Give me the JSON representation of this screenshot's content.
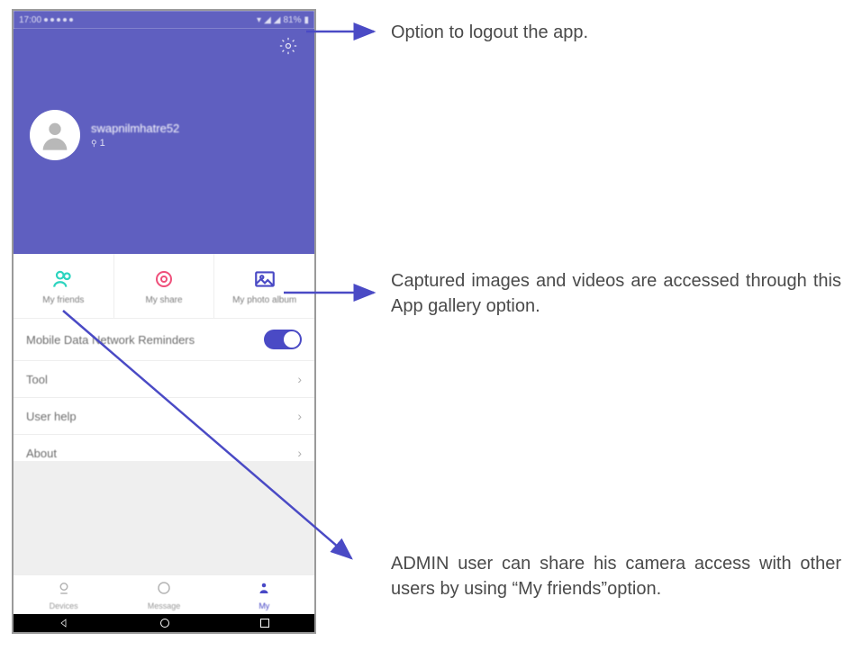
{
  "status": {
    "time": "17:00",
    "right": "81%"
  },
  "header": {
    "username": "swapnilmhatre52",
    "location_count": "1"
  },
  "tiles": [
    {
      "label": "My friends"
    },
    {
      "label": "My share"
    },
    {
      "label": "My photo album"
    }
  ],
  "rows": {
    "mobile_data": "Mobile Data Network Reminders",
    "tool": "Tool",
    "user_help": "User help",
    "about": "About"
  },
  "tabs": {
    "devices": "Devices",
    "message": "Message",
    "my": "My"
  },
  "annotations": {
    "logout": "Option to logout the app.",
    "gallery": "Captured images and videos are accessed through this App gallery option.",
    "friends": "ADMIN user can share his camera access with other users by using “My friends”option."
  }
}
